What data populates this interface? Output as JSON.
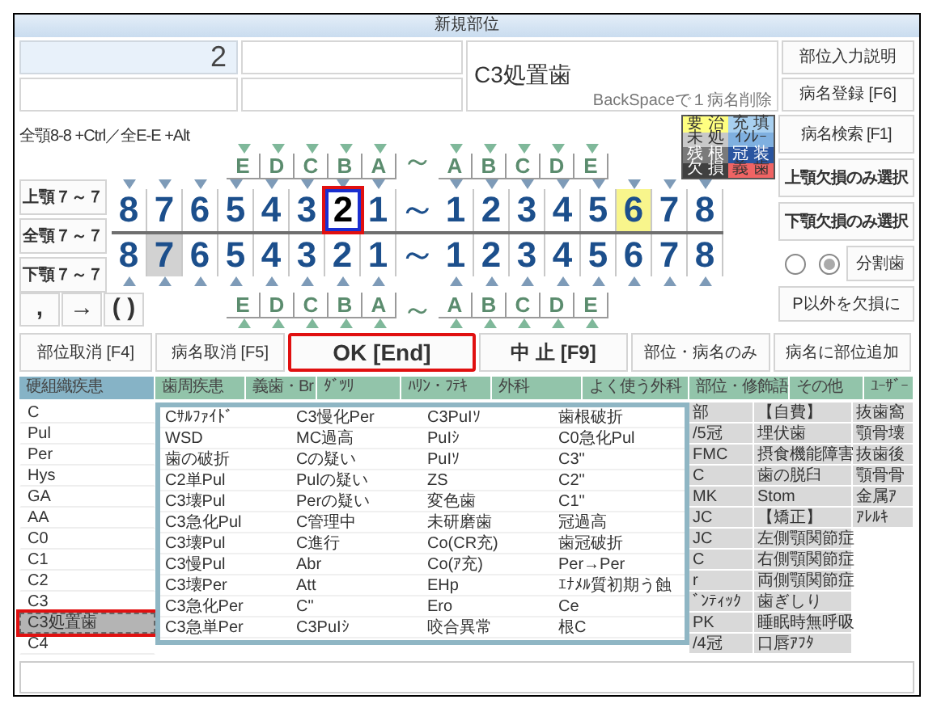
{
  "window": {
    "title": "新規部位"
  },
  "fields": {
    "tooth_number": "2",
    "diagnosis": "C3処置歯",
    "hint": "BackSpaceで１病名削除"
  },
  "top_buttons": [
    "部位入力説明",
    "病名登録 [F6]"
  ],
  "shortcut_hint": "全顎8-8 +Ctrl／全E-E +Alt",
  "jaw_buttons": [
    "上顎７～７",
    "全顎７～７",
    "下顎７～７"
  ],
  "symbol_buttons": [
    ",",
    "→",
    "( )"
  ],
  "legend": [
    {
      "label": "要 治",
      "color": "#ffff80"
    },
    {
      "label": "充 填",
      "color": "#a8d0f0"
    },
    {
      "label": "未 処",
      "color": "#c8c8c8"
    },
    {
      "label": "ｲﾝﾚｰ",
      "color": "#7fb0e0"
    },
    {
      "label": "残 根",
      "color": "#7a7a7a"
    },
    {
      "label": "冠 装",
      "color": "#2a55a0"
    },
    {
      "label": "欠 損",
      "color": "#404040"
    },
    {
      "label": "義 歯",
      "color": "#f06464"
    }
  ],
  "chart": {
    "upper_deciduous": {
      "right": [
        "E",
        "D",
        "C",
        "B",
        "A"
      ],
      "separator": "～",
      "left": [
        "A",
        "B",
        "C",
        "D",
        "E"
      ]
    },
    "upper_permanent": {
      "right": [
        {
          "label": "8",
          "focused": false
        },
        {
          "label": "7",
          "focused": false
        },
        {
          "label": "6",
          "focused": false
        },
        {
          "label": "5",
          "focused": false
        },
        {
          "label": "4",
          "focused": false
        },
        {
          "label": "3",
          "focused": false
        },
        {
          "label": "2",
          "focused": true
        },
        {
          "label": "1",
          "focused": false
        }
      ],
      "separator": "～",
      "left": [
        {
          "label": "1",
          "focused": false
        },
        {
          "label": "2",
          "focused": false
        },
        {
          "label": "3",
          "focused": false
        },
        {
          "label": "4",
          "focused": false
        },
        {
          "label": "5",
          "focused": false
        },
        {
          "label": "6",
          "focused": false,
          "color": "#f8f58c"
        },
        {
          "label": "7",
          "focused": false
        },
        {
          "label": "8",
          "focused": false
        }
      ]
    },
    "lower_permanent": {
      "right": [
        {
          "label": "8",
          "focused": false
        },
        {
          "label": "7",
          "focused": false,
          "color": "#d2d2d2"
        },
        {
          "label": "6",
          "focused": false
        },
        {
          "label": "5",
          "focused": false
        },
        {
          "label": "4",
          "focused": false
        },
        {
          "label": "3",
          "focused": false
        },
        {
          "label": "2",
          "focused": false
        },
        {
          "label": "1",
          "focused": false
        }
      ],
      "separator": "～",
      "left": [
        {
          "label": "1",
          "focused": false
        },
        {
          "label": "2",
          "focused": false
        },
        {
          "label": "3",
          "focused": false
        },
        {
          "label": "4",
          "focused": false
        },
        {
          "label": "5",
          "focused": false
        },
        {
          "label": "6",
          "focused": false
        },
        {
          "label": "7",
          "focused": false
        },
        {
          "label": "8",
          "focused": false
        }
      ]
    },
    "lower_deciduous": {
      "right": [
        "E",
        "D",
        "C",
        "B",
        "A"
      ],
      "separator": "～",
      "left": [
        "A",
        "B",
        "C",
        "D",
        "E"
      ]
    }
  },
  "side_buttons": [
    "病名検索 [F1]",
    "上顎欠損のみ選択",
    "下顎欠損のみ選択"
  ],
  "radios": [
    {
      "selected": false
    },
    {
      "selected": true
    }
  ],
  "split_button": "分割歯",
  "missing_button": "P以外を欠損に",
  "action_buttons": [
    {
      "label": "部位取消 [F4]",
      "kind": "normal",
      "highlighted": false
    },
    {
      "label": "病名取消 [F5]",
      "kind": "normal",
      "highlighted": false
    },
    {
      "label": "OK [End]",
      "kind": "primary",
      "highlighted": true
    },
    {
      "label": "中 止 [F9]",
      "kind": "cancel",
      "highlighted": false
    },
    {
      "label": "部位・病名のみ",
      "kind": "normal",
      "highlighted": false
    },
    {
      "label": "病名に部位追加",
      "kind": "normal",
      "highlighted": false
    }
  ],
  "tabs": [
    {
      "label": "硬組織疾患",
      "selected": true
    },
    {
      "label": "歯周疾患",
      "selected": false
    },
    {
      "label": "義歯・Br",
      "selected": false
    },
    {
      "label": "ﾀﾞﾂﾘ",
      "selected": false
    },
    {
      "label": "ﾊﾘﾝ・ﾌﾃｷ",
      "selected": false
    },
    {
      "label": "外科",
      "selected": false
    },
    {
      "label": "よく使う外科",
      "selected": false
    },
    {
      "label": "部位・修飾語",
      "selected": false
    },
    {
      "label": "その他",
      "selected": false
    },
    {
      "label": "ﾕｰｻﾞｰ",
      "selected": false
    }
  ],
  "disease_list": [
    {
      "label": "C",
      "selected": false
    },
    {
      "label": "Pul",
      "selected": false
    },
    {
      "label": "Per",
      "selected": false
    },
    {
      "label": "Hys",
      "selected": false
    },
    {
      "label": "GA",
      "selected": false
    },
    {
      "label": "AA",
      "selected": false
    },
    {
      "label": "C0",
      "selected": false
    },
    {
      "label": "C1",
      "selected": false
    },
    {
      "label": "C2",
      "selected": false
    },
    {
      "label": "C3",
      "selected": false
    },
    {
      "label": "C3処置歯",
      "selected": true
    },
    {
      "label": "C4",
      "selected": false
    }
  ],
  "popup_columns": [
    [
      "Cｻﾙﾌｧｲﾄﾞ",
      "WSD",
      "歯の破折",
      "C2単Pul",
      "C3壊Pul",
      "C3急化Pul",
      "C3壊Pul",
      "C3慢Pul",
      "C3壊Per",
      "C3急化Per",
      "C3急単Per"
    ],
    [
      "C3慢化Per",
      "MC過高",
      "Cの疑い",
      "Pulの疑い",
      "Perの疑い",
      "C管理中",
      "C進行",
      "Abr",
      "Att",
      "C\"",
      "C3PuIｼ"
    ],
    [
      "C3PuIｿ",
      "PuIｼ",
      "PuIｿ",
      "ZS",
      "変色歯",
      "未研磨歯",
      "Co(CR充)",
      "Co(ｱ充)",
      "EHp",
      "Ero",
      "咬合異常"
    ],
    [
      "歯根破折",
      "C0急化Pul",
      "C3\"",
      "C2\"",
      "C1\"",
      "冠過高",
      "歯冠破折",
      "Per→Per",
      "ｴﾅﾒﾙ質初期う蝕",
      "Ce",
      "根C"
    ]
  ],
  "side_columns": [
    [
      "部",
      "/5冠",
      "FMC",
      "C",
      "MK",
      "JC",
      "JC",
      "C",
      "r",
      "ﾞﾝﾃｨｯｸ",
      "PK",
      "/4冠"
    ],
    [
      "【自費】",
      "埋伏歯",
      "摂食機能障害",
      "歯の脱臼",
      "Stom",
      "【矯正】",
      "左側顎関節症",
      "右側顎関節症",
      "両側顎関節症",
      "歯ぎしり",
      "睡眠時無呼吸",
      "口唇ｱﾌﾀ"
    ],
    [
      "抜歯窩",
      "顎骨壊",
      "抜歯後",
      "顎骨骨",
      "金属ｱ",
      "ｱﾚﾙｷ"
    ]
  ]
}
